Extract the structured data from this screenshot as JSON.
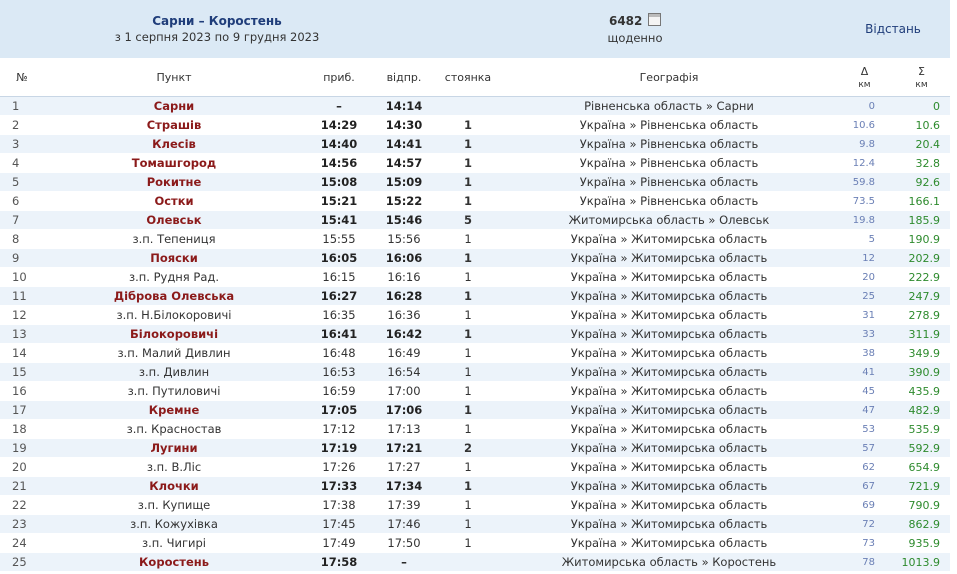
{
  "header": {
    "route_name": "Сарни – Коростень",
    "period": "з 1 серпня 2023 по 9 грудня 2023",
    "train_number": "6482",
    "frequency": "щоденно",
    "distance_label": "Відстань",
    "calendar_icon": "calendar-icon"
  },
  "columns": {
    "no": "№",
    "point": "Пункт",
    "arr": "приб.",
    "dep": "відпр.",
    "stop": "стоянка",
    "geo": "Географія",
    "delta": "Δ",
    "sum": "Σ",
    "unit": "км"
  },
  "stops": [
    {
      "no": "1",
      "name": "Сарни",
      "arr": "–",
      "dep": "14:14",
      "stop": "",
      "geo": "Рівненська область » Сарни",
      "d": "0",
      "s": "0",
      "main": true
    },
    {
      "no": "2",
      "name": "Страшів",
      "arr": "14:29",
      "dep": "14:30",
      "stop": "1",
      "geo": "Україна » Рівненська область",
      "d": "10.6",
      "s": "10.6",
      "main": true
    },
    {
      "no": "3",
      "name": "Клесів",
      "arr": "14:40",
      "dep": "14:41",
      "stop": "1",
      "geo": "Україна » Рівненська область",
      "d": "9.8",
      "s": "20.4",
      "main": true
    },
    {
      "no": "4",
      "name": "Томашгород",
      "arr": "14:56",
      "dep": "14:57",
      "stop": "1",
      "geo": "Україна » Рівненська область",
      "d": "12.4",
      "s": "32.8",
      "main": true
    },
    {
      "no": "5",
      "name": "Рокитне",
      "arr": "15:08",
      "dep": "15:09",
      "stop": "1",
      "geo": "Україна » Рівненська область",
      "d": "59.8",
      "s": "92.6",
      "main": true
    },
    {
      "no": "6",
      "name": "Остки",
      "arr": "15:21",
      "dep": "15:22",
      "stop": "1",
      "geo": "Україна » Рівненська область",
      "d": "73.5",
      "s": "166.1",
      "main": true
    },
    {
      "no": "7",
      "name": "Олевськ",
      "arr": "15:41",
      "dep": "15:46",
      "stop": "5",
      "geo": "Житомирська область » Олевськ",
      "d": "19.8",
      "s": "185.9",
      "main": true
    },
    {
      "no": "8",
      "name": "з.п. Тепениця",
      "arr": "15:55",
      "dep": "15:56",
      "stop": "1",
      "geo": "Україна » Житомирська область",
      "d": "5",
      "s": "190.9",
      "main": false
    },
    {
      "no": "9",
      "name": "Пояски",
      "arr": "16:05",
      "dep": "16:06",
      "stop": "1",
      "geo": "Україна » Житомирська область",
      "d": "12",
      "s": "202.9",
      "main": true
    },
    {
      "no": "10",
      "name": "з.п. Рудня Рад.",
      "arr": "16:15",
      "dep": "16:16",
      "stop": "1",
      "geo": "Україна » Житомирська область",
      "d": "20",
      "s": "222.9",
      "main": false
    },
    {
      "no": "11",
      "name": "Діброва Олевська",
      "arr": "16:27",
      "dep": "16:28",
      "stop": "1",
      "geo": "Україна » Житомирська область",
      "d": "25",
      "s": "247.9",
      "main": true
    },
    {
      "no": "12",
      "name": "з.п. Н.Білокоровичі",
      "arr": "16:35",
      "dep": "16:36",
      "stop": "1",
      "geo": "Україна » Житомирська область",
      "d": "31",
      "s": "278.9",
      "main": false
    },
    {
      "no": "13",
      "name": "Білокоровичі",
      "arr": "16:41",
      "dep": "16:42",
      "stop": "1",
      "geo": "Україна » Житомирська область",
      "d": "33",
      "s": "311.9",
      "main": true
    },
    {
      "no": "14",
      "name": "з.п. Малий Дивлин",
      "arr": "16:48",
      "dep": "16:49",
      "stop": "1",
      "geo": "Україна » Житомирська область",
      "d": "38",
      "s": "349.9",
      "main": false
    },
    {
      "no": "15",
      "name": "з.п. Дивлин",
      "arr": "16:53",
      "dep": "16:54",
      "stop": "1",
      "geo": "Україна » Житомирська область",
      "d": "41",
      "s": "390.9",
      "main": false
    },
    {
      "no": "16",
      "name": "з.п. Путиловичі",
      "arr": "16:59",
      "dep": "17:00",
      "stop": "1",
      "geo": "Україна » Житомирська область",
      "d": "45",
      "s": "435.9",
      "main": false
    },
    {
      "no": "17",
      "name": "Кремне",
      "arr": "17:05",
      "dep": "17:06",
      "stop": "1",
      "geo": "Україна » Житомирська область",
      "d": "47",
      "s": "482.9",
      "main": true
    },
    {
      "no": "18",
      "name": "з.п. Красностав",
      "arr": "17:12",
      "dep": "17:13",
      "stop": "1",
      "geo": "Україна » Житомирська область",
      "d": "53",
      "s": "535.9",
      "main": false
    },
    {
      "no": "19",
      "name": "Лугини",
      "arr": "17:19",
      "dep": "17:21",
      "stop": "2",
      "geo": "Україна » Житомирська область",
      "d": "57",
      "s": "592.9",
      "main": true
    },
    {
      "no": "20",
      "name": "з.п. В.Ліс",
      "arr": "17:26",
      "dep": "17:27",
      "stop": "1",
      "geo": "Україна » Житомирська область",
      "d": "62",
      "s": "654.9",
      "main": false
    },
    {
      "no": "21",
      "name": "Клочки",
      "arr": "17:33",
      "dep": "17:34",
      "stop": "1",
      "geo": "Україна » Житомирська область",
      "d": "67",
      "s": "721.9",
      "main": true
    },
    {
      "no": "22",
      "name": "з.п. Купище",
      "arr": "17:38",
      "dep": "17:39",
      "stop": "1",
      "geo": "Україна » Житомирська область",
      "d": "69",
      "s": "790.9",
      "main": false
    },
    {
      "no": "23",
      "name": "з.п. Кожухівка",
      "arr": "17:45",
      "dep": "17:46",
      "stop": "1",
      "geo": "Україна » Житомирська область",
      "d": "72",
      "s": "862.9",
      "main": false
    },
    {
      "no": "24",
      "name": "з.п. Чигирі",
      "arr": "17:49",
      "dep": "17:50",
      "stop": "1",
      "geo": "Україна » Житомирська область",
      "d": "73",
      "s": "935.9",
      "main": false
    },
    {
      "no": "25",
      "name": "Коростень",
      "arr": "17:58",
      "dep": "–",
      "stop": "",
      "geo": "Житомирська область » Коростень",
      "d": "78",
      "s": "1013.9",
      "main": true
    }
  ]
}
